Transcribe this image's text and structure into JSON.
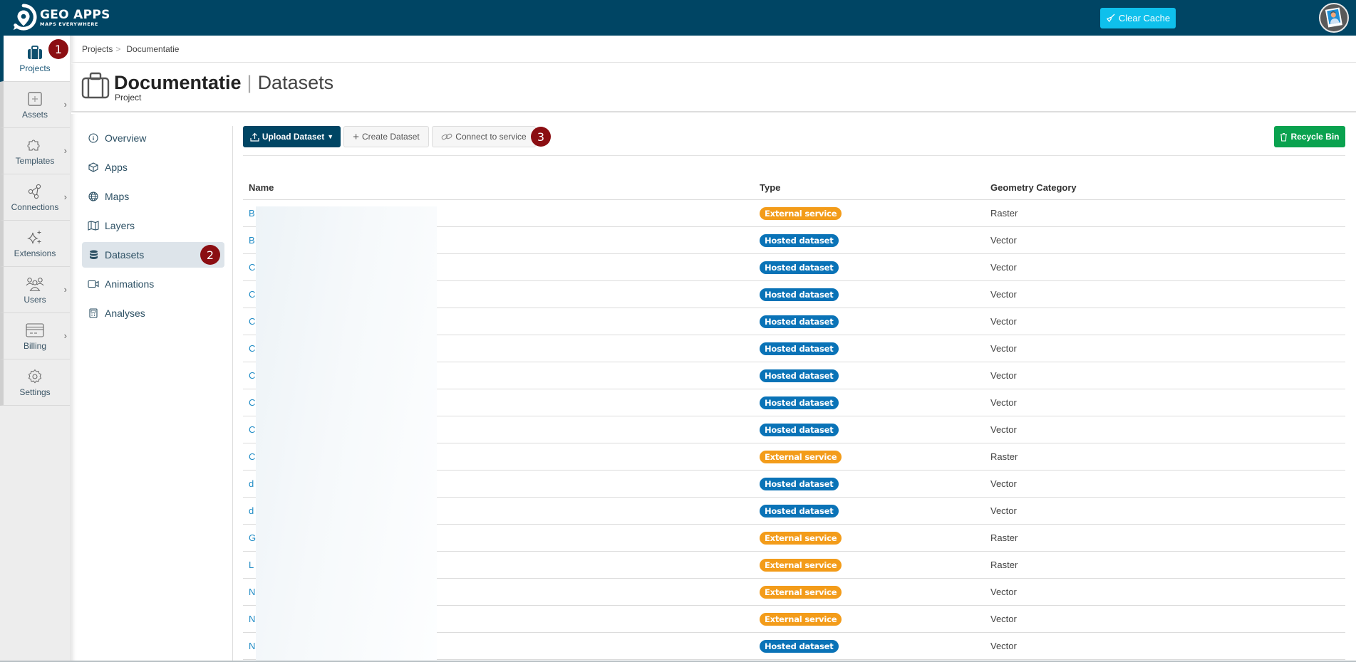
{
  "app": {
    "logo_title": "GEO APPS",
    "logo_subtitle": "MAPS EVERYWHERE",
    "clear_cache_label": "Clear Cache",
    "brand_color": "#004564"
  },
  "sidebar": {
    "items": [
      {
        "label": "Projects",
        "icon": "briefcase-icon",
        "active": true,
        "chevron": false,
        "badge": "1"
      },
      {
        "label": "Assets",
        "icon": "plus-square-icon",
        "active": false,
        "chevron": true
      },
      {
        "label": "Templates",
        "icon": "puzzle-icon",
        "active": false,
        "chevron": true
      },
      {
        "label": "Connections",
        "icon": "share-nodes-icon",
        "active": false,
        "chevron": true
      },
      {
        "label": "Extensions",
        "icon": "sparkle-icon",
        "active": false,
        "chevron": false
      },
      {
        "label": "Users",
        "icon": "users-icon",
        "active": false,
        "chevron": true
      },
      {
        "label": "Billing",
        "icon": "credit-card-icon",
        "active": false,
        "chevron": true
      },
      {
        "label": "Settings",
        "icon": "gear-icon",
        "active": false,
        "chevron": false
      }
    ]
  },
  "breadcrumb": {
    "items": [
      "Projects",
      "Documentatie"
    ],
    "separator": ">"
  },
  "header": {
    "title": "Documentatie",
    "separator": "|",
    "section": "Datasets",
    "caption": "Project"
  },
  "subnav": {
    "items": [
      {
        "label": "Overview",
        "icon": "info-icon",
        "active": false
      },
      {
        "label": "Apps",
        "icon": "cube-icon",
        "active": false
      },
      {
        "label": "Maps",
        "icon": "globe-icon",
        "active": false
      },
      {
        "label": "Layers",
        "icon": "map-icon",
        "active": false
      },
      {
        "label": "Datasets",
        "icon": "database-icon",
        "active": true,
        "badge": "2"
      },
      {
        "label": "Animations",
        "icon": "video-icon",
        "active": false
      },
      {
        "label": "Analyses",
        "icon": "calculator-icon",
        "active": false
      }
    ]
  },
  "toolbar": {
    "upload_label": "Upload Dataset",
    "create_label": "Create Dataset",
    "connect_label": "Connect to service",
    "connect_badge": "3",
    "recycle_label": "Recycle Bin"
  },
  "table": {
    "columns": [
      "Name",
      "Type",
      "Geometry Category"
    ],
    "type_colors": {
      "External service": "#f39c1a",
      "Hosted dataset": "#0a73b7"
    },
    "rows": [
      {
        "name": "B",
        "type": "External service",
        "geometry": "Raster"
      },
      {
        "name": "B",
        "type": "Hosted dataset",
        "geometry": "Vector"
      },
      {
        "name": "C",
        "type": "Hosted dataset",
        "geometry": "Vector"
      },
      {
        "name": "C",
        "type": "Hosted dataset",
        "geometry": "Vector"
      },
      {
        "name": "C",
        "type": "Hosted dataset",
        "geometry": "Vector"
      },
      {
        "name": "C",
        "type": "Hosted dataset",
        "geometry": "Vector"
      },
      {
        "name": "C",
        "type": "Hosted dataset",
        "geometry": "Vector"
      },
      {
        "name": "C",
        "type": "Hosted dataset",
        "geometry": "Vector"
      },
      {
        "name": "C",
        "type": "Hosted dataset",
        "geometry": "Vector"
      },
      {
        "name": "C",
        "type": "External service",
        "geometry": "Raster"
      },
      {
        "name": "d",
        "type": "Hosted dataset",
        "geometry": "Vector"
      },
      {
        "name": "d",
        "type": "Hosted dataset",
        "geometry": "Vector"
      },
      {
        "name": "G",
        "type": "External service",
        "geometry": "Raster"
      },
      {
        "name": "L",
        "type": "External service",
        "geometry": "Raster"
      },
      {
        "name": "N",
        "type": "External service",
        "geometry": "Vector"
      },
      {
        "name": "N",
        "type": "External service",
        "geometry": "Vector"
      },
      {
        "name": "N",
        "type": "Hosted dataset",
        "geometry": "Vector"
      }
    ]
  }
}
